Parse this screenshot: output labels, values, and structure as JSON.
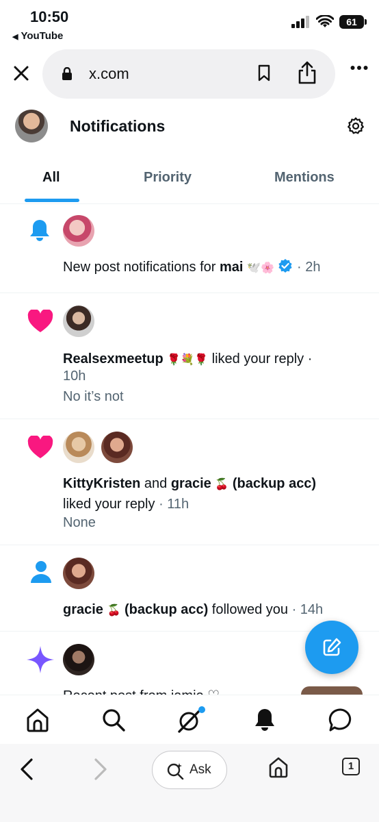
{
  "status": {
    "time": "10:50",
    "back_app": "YouTube",
    "battery": "61"
  },
  "browser": {
    "url": "x.com",
    "ask_label": "Ask",
    "tab_count": "1"
  },
  "header": {
    "title": "Notifications"
  },
  "tabs": [
    {
      "label": "All",
      "active": true
    },
    {
      "label": "Priority",
      "active": false
    },
    {
      "label": "Mentions",
      "active": false
    }
  ],
  "notifications": [
    {
      "type": "bell",
      "pre": "New post notifications for ",
      "user": "mai",
      "emoji": "🕊️🌸",
      "time": "· 2h"
    },
    {
      "type": "like",
      "user": "Realsexmeetup",
      "emoji": "🌹💐🌹",
      "action": " liked your reply ·",
      "time": "10h",
      "quote": "No it’s not"
    },
    {
      "type": "like",
      "user1": "KittyKristen",
      "and": " and ",
      "user2": "gracie",
      "emoji": "🍒",
      "user2_suffix": "(backup acc)",
      "action": "liked your reply",
      "time": "· 11h",
      "quote": "None"
    },
    {
      "type": "follow",
      "user": "gracie",
      "emoji": "🍒",
      "user_suffix": "(backup acc)",
      "action": " followed you",
      "time": "· 14h"
    },
    {
      "type": "sparkle",
      "partial": "Recent post from jamie ♡"
    }
  ],
  "colors": {
    "accent": "#1d9bf0",
    "like": "#f91880",
    "sparkle": "#7856ff"
  }
}
